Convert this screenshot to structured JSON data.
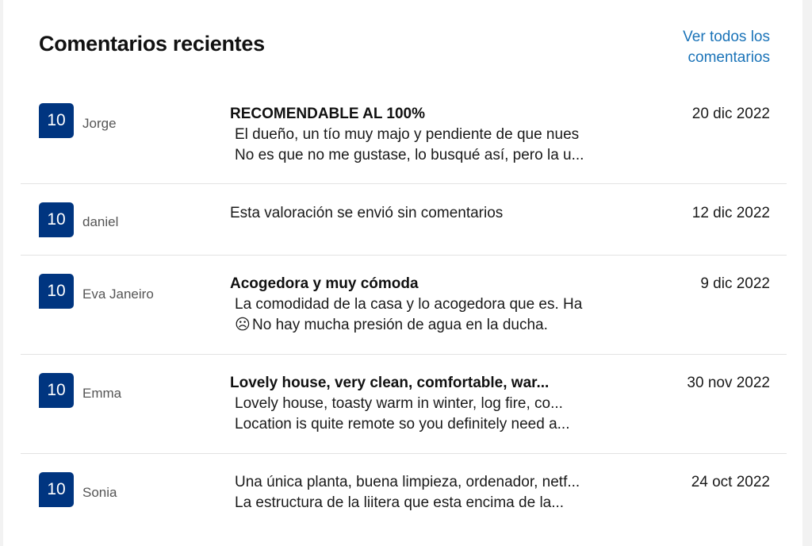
{
  "header": {
    "title": "Comentarios recientes",
    "see_all_line1": "Ver todos los",
    "see_all_line2": "comentarios"
  },
  "reviews": [
    {
      "score": "10",
      "author": "Jorge",
      "title": "RECOMENDABLE AL 100%",
      "positive": "El dueño, un tío muy majo y pendiente de que nues",
      "negative": "No es que no me gustase, lo busqué así, pero la u...",
      "date": "20 dic 2022"
    },
    {
      "score": "10",
      "author": "daniel",
      "text": "Esta valoración se envió sin comentarios",
      "date": "12 dic 2022"
    },
    {
      "score": "10",
      "author": "Eva Janeiro",
      "title": "Acogedora y muy cómoda",
      "positive": "La comodidad de la casa y lo acogedora que es. Ha",
      "negative_icon": "☹",
      "negative": "No hay mucha presión de agua en la ducha.",
      "date": "9 dic 2022"
    },
    {
      "score": "10",
      "author": "Emma",
      "title": "Lovely house, very clean, comfortable, war...",
      "positive": "Lovely house, toasty warm in winter, log fire, co...",
      "negative": "Location is quite remote so you definitely need a...",
      "date": "30 nov 2022"
    },
    {
      "score": "10",
      "author": "Sonia",
      "positive": "Una única planta, buena limpieza, ordenador, netf...",
      "negative": "La estructura de la liitera que esta encima de la...",
      "date": "24 oct 2022"
    }
  ],
  "colors": {
    "score_badge": "#003580",
    "link": "#1a73b8"
  }
}
